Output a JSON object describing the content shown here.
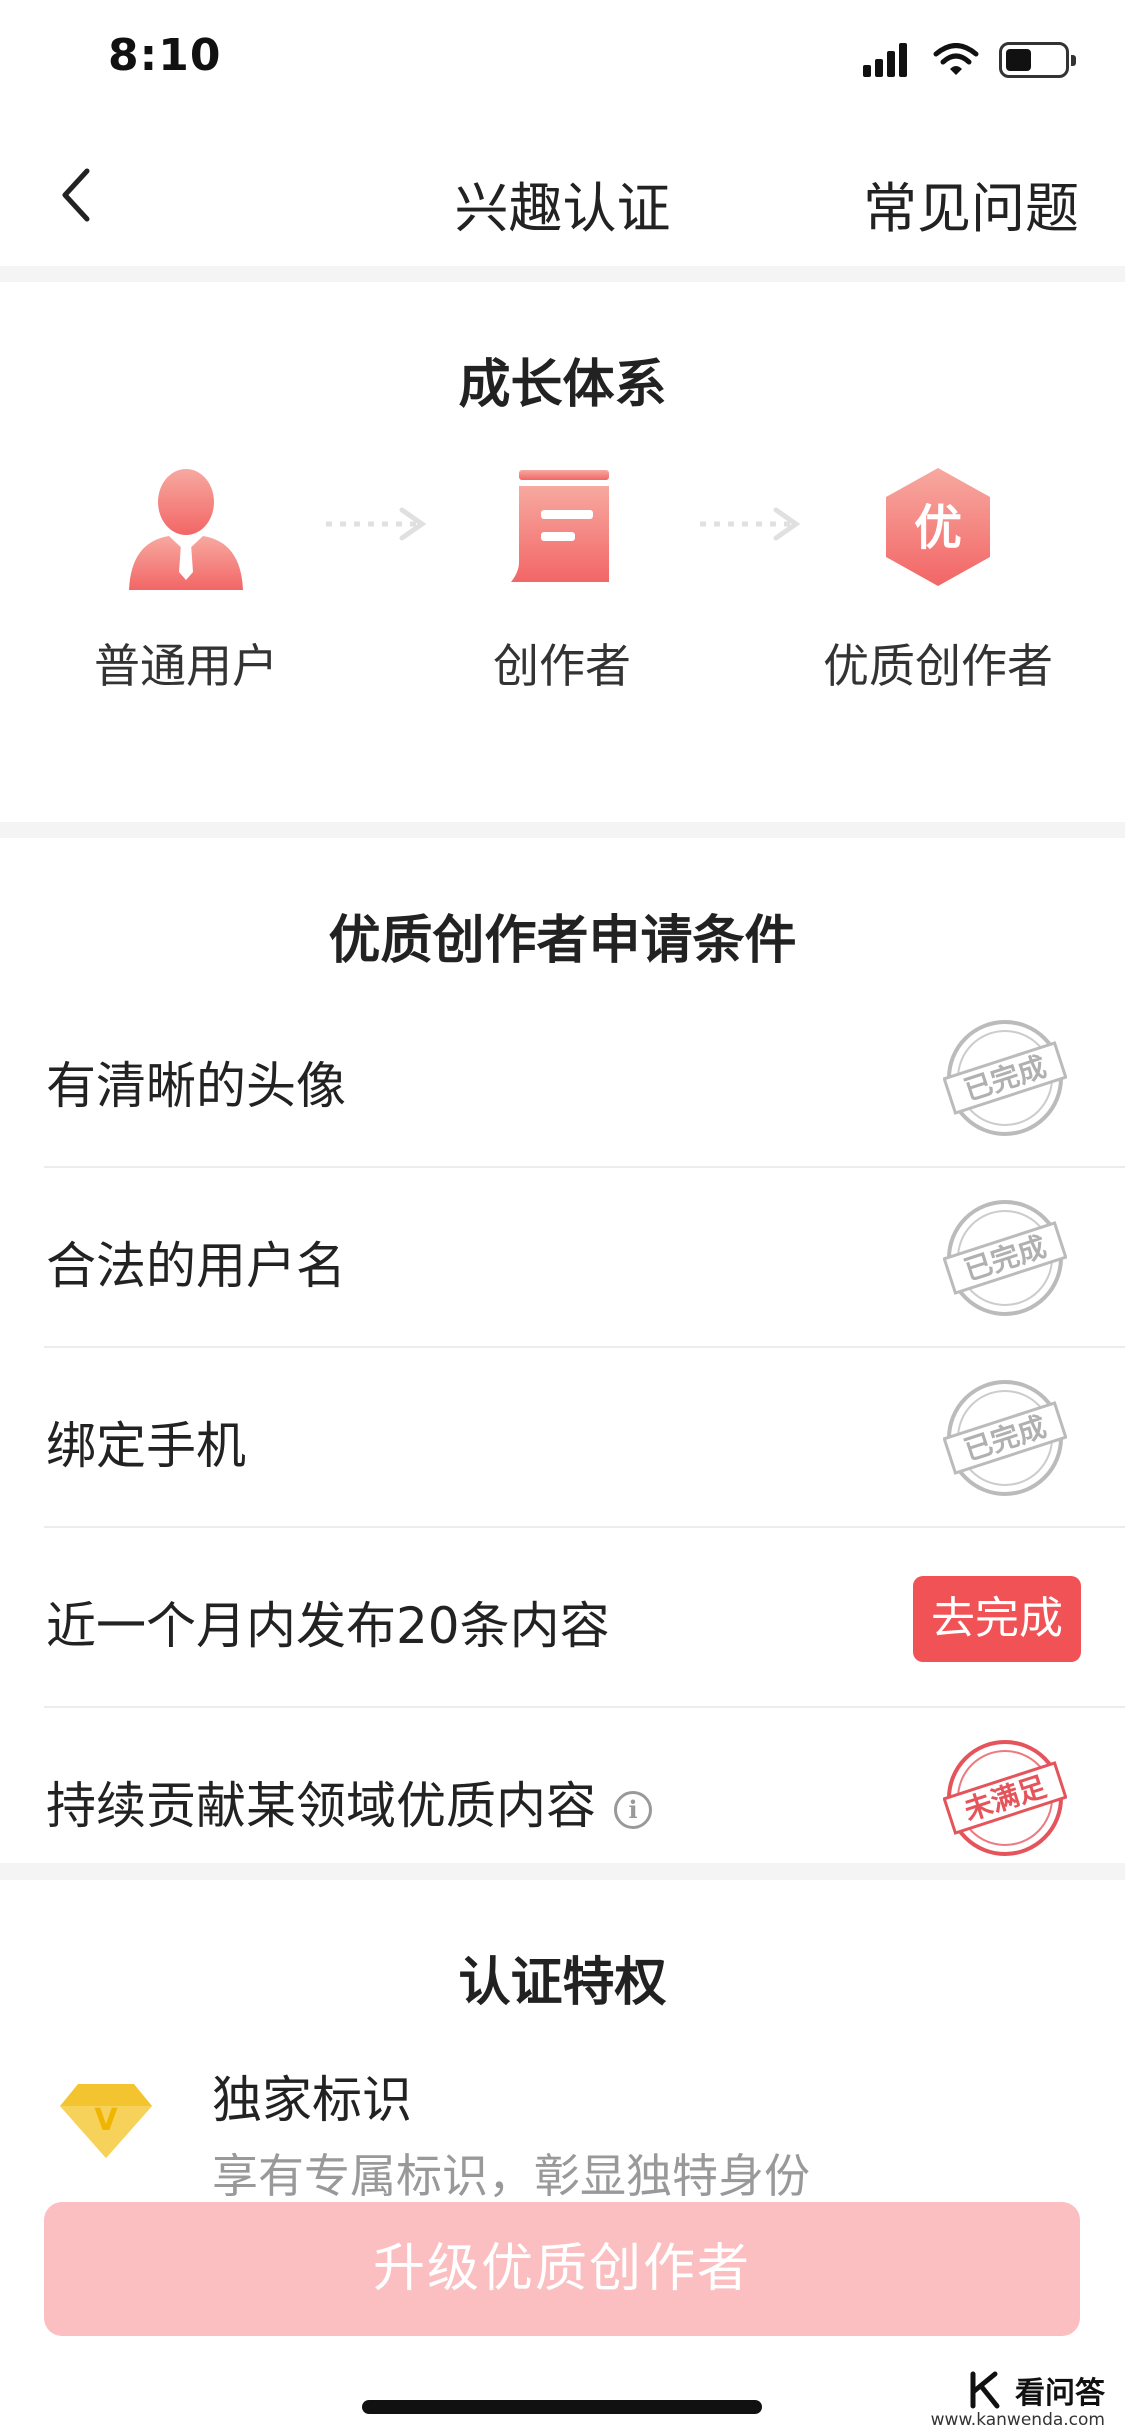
{
  "status_bar": {
    "time": "8:10",
    "battery_level": 0.45
  },
  "nav": {
    "back_icon": "chevron-left-icon",
    "title": "兴趣认证",
    "faq_label": "常见问题"
  },
  "growth": {
    "title": "成长体系",
    "stages": [
      {
        "label": "普通用户",
        "icon": "user-icon"
      },
      {
        "label": "创作者",
        "icon": "document-icon"
      },
      {
        "label": "优质创作者",
        "icon": "quality-badge-icon",
        "badge_char": "优"
      }
    ]
  },
  "requirements": {
    "title": "优质创作者申请条件",
    "items": [
      {
        "text": "有清晰的头像",
        "status": "done",
        "stamp_text": "已完成"
      },
      {
        "text": "合法的用户名",
        "status": "done",
        "stamp_text": "已完成"
      },
      {
        "text": "绑定手机",
        "status": "done",
        "stamp_text": "已完成"
      },
      {
        "text": "近一个月内发布20条内容",
        "status": "todo",
        "action_label": "去完成"
      },
      {
        "text": "持续贡献某领域优质内容",
        "status": "unmet",
        "stamp_text": "未满足",
        "info_icon": "info-icon"
      }
    ]
  },
  "privileges": {
    "title": "认证特权",
    "items": [
      {
        "icon": "diamond-v-icon",
        "badge_char": "V",
        "title": "独家标识",
        "desc": "享有专属标识，彰显独特身份"
      }
    ]
  },
  "upgrade_button": {
    "label": "升级优质创作者"
  },
  "watermark": {
    "text": "看问答",
    "sub": "www.kanwenda.com"
  },
  "colors": {
    "accent": "#f05256",
    "gradient_start": "#f7a9a0",
    "gradient_end": "#f26666",
    "button_disabled": "#fbbfc1",
    "stamp_gray": "#bbbbbb",
    "stamp_red": "#e5545b",
    "diamond": "#f4c430"
  }
}
